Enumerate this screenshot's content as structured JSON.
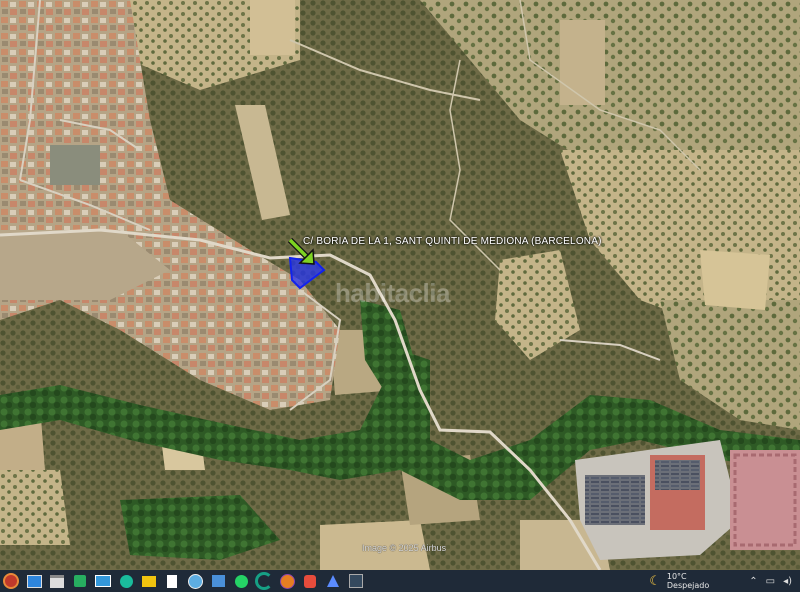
{
  "map": {
    "address_label": "C/ BORIA DE LA 1, SANT QUINTI DE MEDIONA (BARCELONA)",
    "watermark": "habitaclia",
    "imagery_credit": "Image © 2025 Airbus",
    "marker_color": "#2233ff",
    "arrow_color": "#7ed321"
  },
  "taskbar": {
    "apps": [
      {
        "name": "start-button-icon"
      },
      {
        "name": "desktop-app-icon"
      },
      {
        "name": "folder-icon"
      },
      {
        "name": "security-app-icon"
      },
      {
        "name": "photos-app-icon"
      },
      {
        "name": "edge-browser-icon"
      },
      {
        "name": "file-explorer-icon"
      },
      {
        "name": "document-icon"
      },
      {
        "name": "globe-app-icon"
      },
      {
        "name": "store-app-icon"
      },
      {
        "name": "whatsapp-icon"
      },
      {
        "name": "curved-app-icon"
      },
      {
        "name": "firefox-icon"
      },
      {
        "name": "brave-browser-icon"
      },
      {
        "name": "arrow-app-icon"
      },
      {
        "name": "maps-app-icon"
      }
    ],
    "weather_temp": "10°C",
    "weather_desc": "Despejado"
  }
}
